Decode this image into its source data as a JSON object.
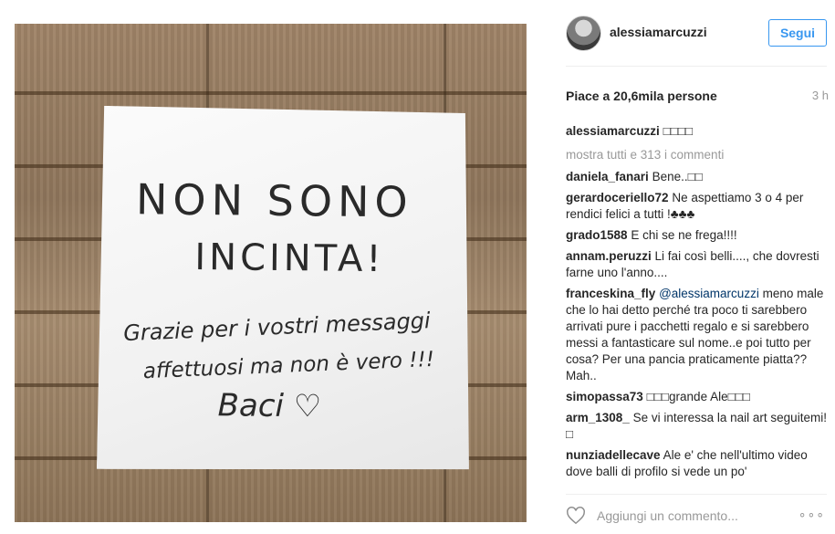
{
  "post": {
    "username": "alessiamarcuzzi",
    "follow_label": "Segui",
    "likes": "Piace a 20,6mila persone",
    "time": "3 h",
    "caption_user": "alessiamarcuzzi",
    "caption_text": "□□□□",
    "show_all": "mostra tutti e 313 i commenti",
    "add_comment_placeholder": "Aggiungi un commento...",
    "more_icon": "ellipsis-icon"
  },
  "note": {
    "line1": "NON SONO",
    "line2": "INCINTA!",
    "line3": "Grazie per i vostri messaggi",
    "line4": "affettuosi ma non è vero !!!",
    "line5": "Baci ♡"
  },
  "comments": [
    {
      "user": "daniela_fanari",
      "text": "Bene..□□"
    },
    {
      "user": "gerardoceriello72",
      "text": "Ne aspettiamo 3 o 4 per rendici felici a tutti !♣♣♣"
    },
    {
      "user": "grado1588",
      "text": "E chi se ne frega!!!!"
    },
    {
      "user": "annam.peruzzi",
      "text": "Li fai così belli...., che dovresti farne uno l'anno...."
    },
    {
      "user": "franceskina_fly",
      "mention": "@alessiamarcuzzi",
      "text": "meno male che lo hai detto perché tra poco ti sarebbero arrivati pure i pacchetti regalo e si sarebbero messi a fantasticare sul nome..e poi tutto per cosa? Per una pancia praticamente piatta?? Mah.."
    },
    {
      "user": "simopassa73",
      "text": "□□□grande Ale□□□"
    },
    {
      "user": "arm_1308_",
      "text": "Se vi interessa la nail art seguitemi! □"
    },
    {
      "user": "nunziadellecave",
      "text": "Ale e' che nell'ultimo video dove balli di profilo si vede un po'"
    }
  ]
}
